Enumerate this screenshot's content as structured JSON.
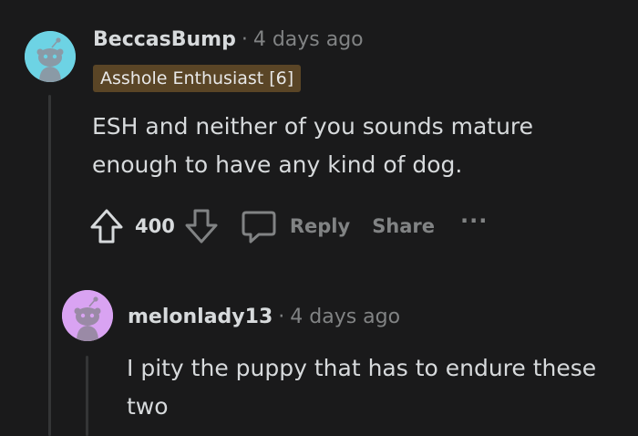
{
  "comments": [
    {
      "username": "BeccasBump",
      "separator": "·",
      "timestamp": "4 days ago",
      "flair": "Asshole Enthusiast [6]",
      "body": "ESH and neither of you sounds mature enough to have any kind of dog.",
      "votes": "400",
      "reply_label": "Reply",
      "share_label": "Share",
      "more_label": "···",
      "avatar_color": "#6dd3e4"
    },
    {
      "username": "melonlady13",
      "separator": "·",
      "timestamp": "4 days ago",
      "body": "I pity the puppy that has to endure these two",
      "avatar_color": "#d9a3f2"
    }
  ],
  "colors": {
    "background": "#1a1a1b",
    "text": "#d7dadc",
    "muted": "#818384",
    "flair_bg": "#5a4526",
    "thread_line": "#343536"
  },
  "icons": [
    "upvote-arrow-icon",
    "downvote-arrow-icon",
    "comment-bubble-icon",
    "snoo-avatar-icon"
  ]
}
